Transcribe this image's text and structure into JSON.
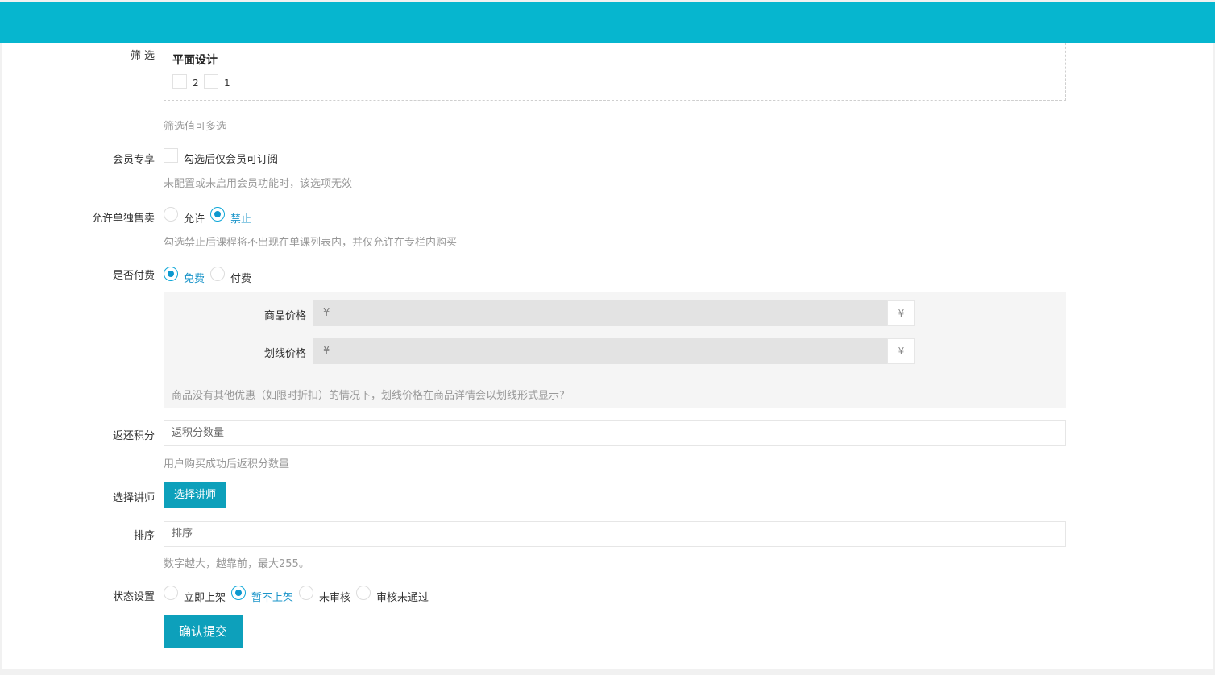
{
  "form": {
    "filter": {
      "label": "筛 选",
      "group_title": "平面设计",
      "options": [
        "2",
        "1"
      ],
      "help": "筛选值可多选"
    },
    "member": {
      "label": "会员专享",
      "checkbox_label": "勾选后仅会员可订阅",
      "help": "未配置或未启用会员功能时，该选项无效"
    },
    "single_sale": {
      "label": "允许单独售卖",
      "options": [
        "允许",
        "禁止"
      ],
      "selected": "禁止",
      "help": "勾选禁止后课程将不出现在单课列表内，并仅允许在专栏内购买"
    },
    "paid": {
      "label": "是否付费",
      "options": [
        "免费",
        "付费"
      ],
      "selected": "免费",
      "price_label": "商品价格",
      "price_prefix": "¥",
      "price_addon": "¥",
      "strike_label": "划线价格",
      "strike_prefix": "¥",
      "strike_addon": "¥",
      "price_help": "商品没有其他优惠（如限时折扣）的情况下，划线价格在商品详情会以划线形式显示?"
    },
    "points": {
      "label": "返还积分",
      "placeholder": "返积分数量",
      "help": "用户购买成功后返积分数量"
    },
    "teacher": {
      "label": "选择讲师",
      "button": "选择讲师"
    },
    "sort": {
      "label": "排序",
      "placeholder": "排序",
      "help": "数字越大，越靠前，最大255。"
    },
    "status": {
      "label": "状态设置",
      "options": [
        "立即上架",
        "暂不上架",
        "未审核",
        "审核未通过"
      ],
      "selected": "暂不上架"
    },
    "submit": "确认提交"
  },
  "colors": {
    "topbar": "#06b6cf",
    "button": "#0da0bb",
    "radio_checked": "#0c98cf"
  }
}
